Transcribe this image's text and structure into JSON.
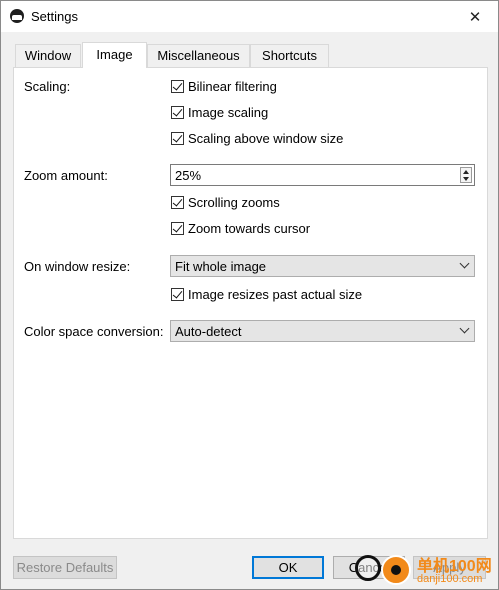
{
  "window": {
    "title": "Settings",
    "app_icon": "app-logo-icon",
    "close_glyph": "✕"
  },
  "tabs": [
    {
      "label": "Window",
      "active": false
    },
    {
      "label": "Image",
      "active": true
    },
    {
      "label": "Miscellaneous",
      "active": false
    },
    {
      "label": "Shortcuts",
      "active": false
    }
  ],
  "image_tab": {
    "scaling": {
      "label": "Scaling:",
      "bilinear_filtering": {
        "label": "Bilinear filtering",
        "checked": true
      },
      "image_scaling": {
        "label": "Image scaling",
        "checked": true
      },
      "scaling_above_window_size": {
        "label": "Scaling above window size",
        "checked": true
      }
    },
    "zoom": {
      "label": "Zoom amount:",
      "value": "25%",
      "scrolling_zooms": {
        "label": "Scrolling zooms",
        "checked": true
      },
      "zoom_towards_cursor": {
        "label": "Zoom towards cursor",
        "checked": true
      }
    },
    "window_resize": {
      "label": "On window resize:",
      "selected": "Fit whole image",
      "image_resizes_past_actual_size": {
        "label": "Image resizes past actual size",
        "checked": true
      }
    },
    "color_space": {
      "label": "Color space conversion:",
      "selected": "Auto-detect"
    }
  },
  "buttons": {
    "restore_defaults": "Restore Defaults",
    "ok": "OK",
    "cancel": "Cancel",
    "apply": "Apply"
  },
  "watermark": {
    "text1": "单机100网",
    "text2": "danji100.com"
  },
  "colors": {
    "accent": "#0078d7",
    "watermark": "#f28a1a"
  }
}
